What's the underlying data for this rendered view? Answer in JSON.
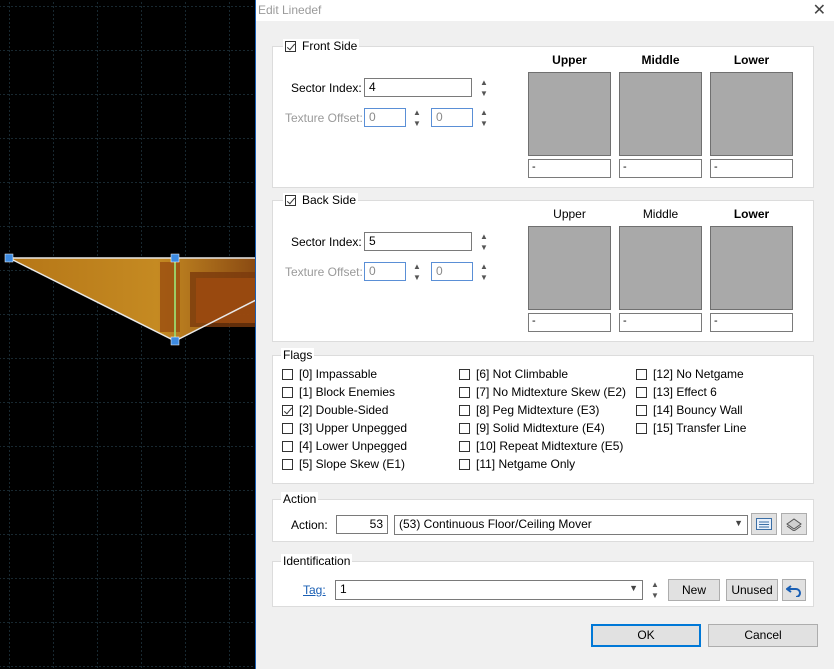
{
  "dialog": {
    "title": "Edit Linedef",
    "close_glyph": "✕"
  },
  "front": {
    "label": "Front Side",
    "checked": true,
    "sector_label": "Sector Index:",
    "sector_value": "4",
    "offset_label": "Texture Offset:",
    "offset_x": "0",
    "offset_y": "0",
    "headers": [
      "Upper",
      "Middle",
      "Lower"
    ],
    "textures": [
      "-",
      "-",
      "-"
    ]
  },
  "back": {
    "label": "Back Side",
    "checked": true,
    "sector_label": "Sector Index:",
    "sector_value": "5",
    "offset_label": "Texture Offset:",
    "offset_x": "0",
    "offset_y": "0",
    "headers": [
      "Upper",
      "Middle",
      "Lower"
    ],
    "textures": [
      "-",
      "-",
      "-"
    ]
  },
  "flags": {
    "label": "Flags",
    "items": [
      {
        "label": "[0] Impassable",
        "checked": false
      },
      {
        "label": "[1] Block Enemies",
        "checked": false
      },
      {
        "label": "[2] Double-Sided",
        "checked": true
      },
      {
        "label": "[3] Upper Unpegged",
        "checked": false
      },
      {
        "label": "[4] Lower Unpegged",
        "checked": false
      },
      {
        "label": "[5] Slope Skew (E1)",
        "checked": false
      },
      {
        "label": "[6] Not Climbable",
        "checked": false
      },
      {
        "label": "[7] No Midtexture Skew (E2)",
        "checked": false
      },
      {
        "label": "[8] Peg Midtexture (E3)",
        "checked": false
      },
      {
        "label": "[9] Solid Midtexture (E4)",
        "checked": false
      },
      {
        "label": "[10] Repeat Midtexture (E5)",
        "checked": false
      },
      {
        "label": "[11] Netgame Only",
        "checked": false
      },
      {
        "label": "[12] No Netgame",
        "checked": false
      },
      {
        "label": "[13] Effect 6",
        "checked": false
      },
      {
        "label": "[14] Bouncy Wall",
        "checked": false
      },
      {
        "label": "[15] Transfer Line",
        "checked": false
      }
    ]
  },
  "action": {
    "group_label": "Action",
    "label": "Action:",
    "number": "53",
    "selected": "(53) Continuous Floor/Ceiling Mover"
  },
  "identification": {
    "group_label": "Identification",
    "tag_label": "Tag:",
    "tag_value": "1",
    "new_label": "New",
    "unused_label": "Unused"
  },
  "buttons": {
    "ok": "OK",
    "cancel": "Cancel"
  },
  "colors": {
    "grid": "#1e3a4a",
    "sector": "#b06a14",
    "accent": "#0078d7",
    "texture": "#a9a9a9"
  }
}
